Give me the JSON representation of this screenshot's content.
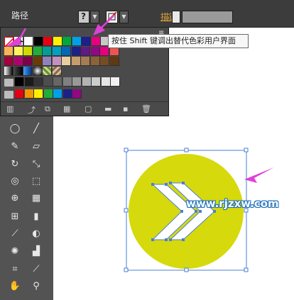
{
  "control_bar": {
    "object_type": "路径",
    "fill_button_glyph": "?",
    "stroke_label": "描边",
    "stroke_colon": ":"
  },
  "tooltip": {
    "text": "按住 Shift 键调出替代色彩用户界面"
  },
  "watermark": {
    "text": "www.rjzxw.com"
  },
  "colors": {
    "panel_bg": "#4a4a4a",
    "toolbar_bg": "#535353",
    "circle_fill": "#d6d90c",
    "selection": "#4a7fd6",
    "arrow_annotation": "#e23fd7",
    "stroke_label": "#e0a33c"
  },
  "swatches": {
    "row1": [
      "#ffffff",
      "#000000",
      "#e60012",
      "#fff100",
      "#00a73c",
      "#00a0e9",
      "#1d2088",
      "#e4007f",
      "#c8c8c8",
      "#7d7d7d",
      "#a40000",
      "#f39800",
      "#8fc31f",
      "#13ae67",
      "#00479d",
      "#920783"
    ],
    "row2": [
      "#f8b551",
      "#fff45c",
      "#cfdb00",
      "#22ac38",
      "#009e96",
      "#00a0c1",
      "#0068b7",
      "#1d2088",
      "#601986",
      "#920783",
      "#e4007f",
      "#ea5550"
    ],
    "row3": [
      "#a3003c",
      "#b0006e",
      "#7d0048",
      "#6a3906",
      "#8f82bc",
      "#c490bf",
      "#e5ce9f",
      "#c69c6d",
      "#a67c52",
      "#8c6239",
      "#754c24",
      "#603813"
    ],
    "row4_special": [
      "gradient-gray",
      "gradient-black",
      "gradient-blue",
      "gradient-radial",
      "pattern-1",
      "pattern-2"
    ],
    "row5_grays": [
      "#000000",
      "#1a1a1a",
      "#333333",
      "#4d4d4d",
      "#666666",
      "#808080",
      "#999999",
      "#b3b3b3",
      "#cccccc",
      "#e6e6e6",
      "#f2f2f2"
    ],
    "row6": [
      "#e60012",
      "#f39800",
      "#fff100",
      "#22ac38",
      "#00a0e9",
      "#1d2088",
      "#920783"
    ]
  },
  "panel_bottom_icons": [
    "swatch-libraries-icon",
    "place-swatch-icon",
    "show-kinds-icon",
    "swatch-options-icon",
    "new-color-group-icon",
    "new-swatch-icon",
    "delete-swatch-icon"
  ],
  "tools": [
    "ellipse-tool-icon",
    "paintbrush-tool-icon",
    "pencil-tool-icon",
    "eraser-tool-icon",
    "rotate-tool-icon",
    "scale-tool-icon",
    "warp-tool-icon",
    "free-transform-tool-icon",
    "shape-builder-tool-icon",
    "perspective-grid-tool-icon",
    "mesh-tool-icon",
    "gradient-tool-icon",
    "eyedropper-tool-icon",
    "blend-tool-icon",
    "symbol-sprayer-tool-icon",
    "column-graph-tool-icon",
    "artboard-tool-icon",
    "slice-tool-icon",
    "hand-tool-icon",
    "zoom-tool-icon"
  ]
}
